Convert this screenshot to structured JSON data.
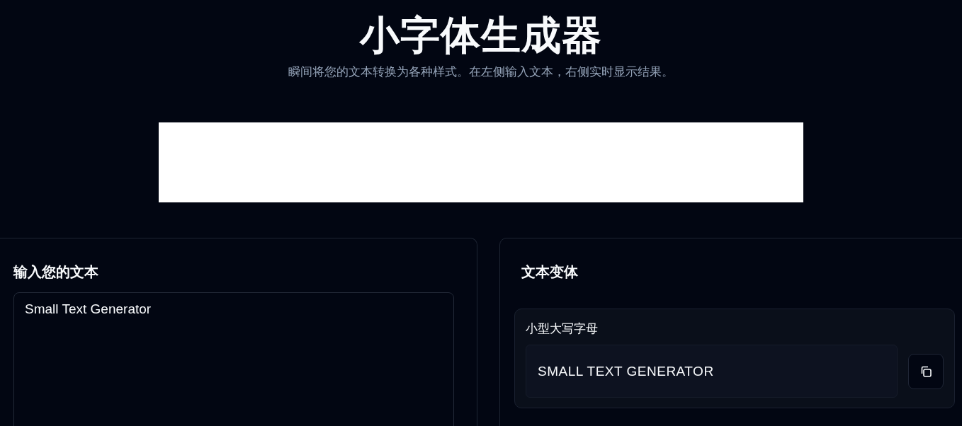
{
  "header": {
    "title": "小字体生成器",
    "subtitle": "瞬间将您的文本转换为各种样式。在左侧输入文本，右侧实时显示结果。"
  },
  "input_panel": {
    "title": "输入您的文本",
    "value": "Small Text Generator"
  },
  "variants_panel": {
    "title": "文本变体",
    "variants": [
      {
        "label": "小型大写字母",
        "result": "SMALL TEXT GENERATOR"
      }
    ]
  }
}
